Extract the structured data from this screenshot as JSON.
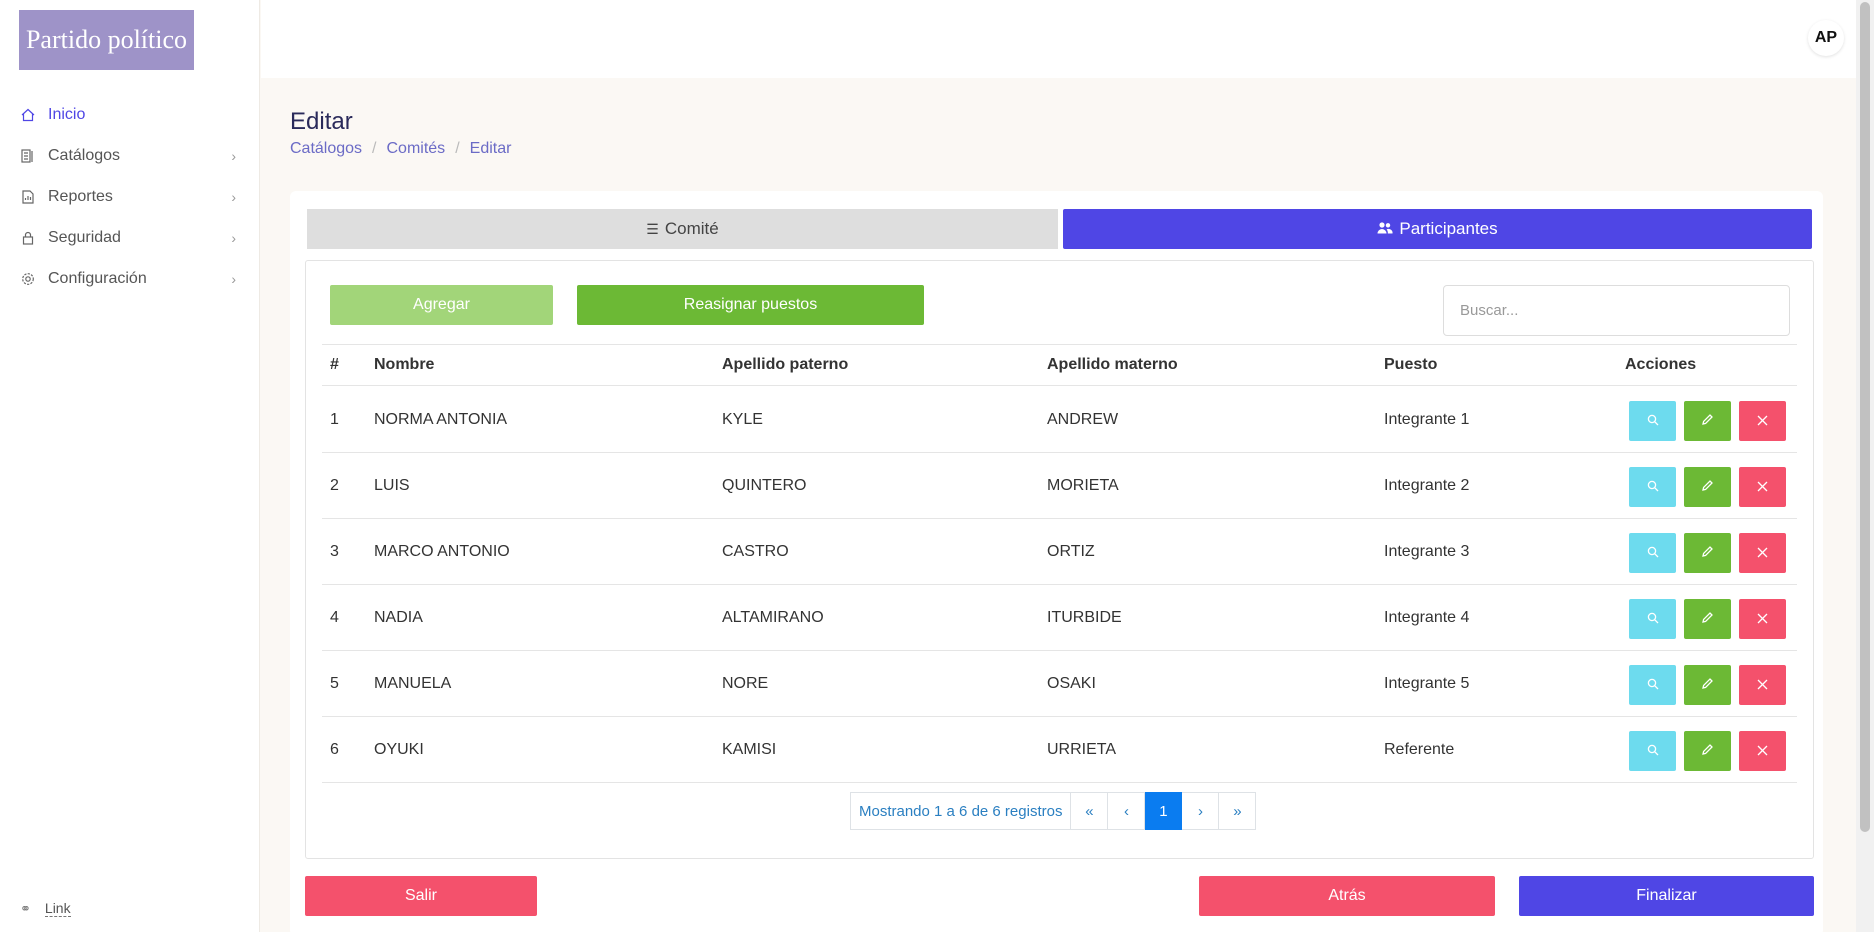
{
  "sidebar": {
    "logo": "Partido político",
    "items": [
      {
        "label": "Inicio",
        "icon": "home-icon"
      },
      {
        "label": "Catálogos",
        "icon": "catalog-icon"
      },
      {
        "label": "Reportes",
        "icon": "report-icon"
      },
      {
        "label": "Seguridad",
        "icon": "lock-icon"
      },
      {
        "label": "Configuración",
        "icon": "gear-icon"
      }
    ],
    "footer_link": "Link"
  },
  "topbar": {
    "avatar_initials": "AP"
  },
  "page": {
    "title": "Editar",
    "breadcrumb": [
      "Catálogos",
      "Comités",
      "Editar"
    ]
  },
  "tabs": {
    "comite": "Comité",
    "participantes": "Participantes"
  },
  "toolbar": {
    "agregar": "Agregar",
    "reasignar": "Reasignar puestos",
    "search_placeholder": "Buscar..."
  },
  "table": {
    "headers": {
      "num": "#",
      "nombre": "Nombre",
      "paterno": "Apellido paterno",
      "materno": "Apellido materno",
      "puesto": "Puesto",
      "acciones": "Acciones"
    },
    "rows": [
      {
        "num": "1",
        "nombre": "NORMA ANTONIA",
        "paterno": "KYLE",
        "materno": "ANDREW",
        "puesto": "Integrante 1"
      },
      {
        "num": "2",
        "nombre": "LUIS",
        "paterno": "QUINTERO",
        "materno": "MORIETA",
        "puesto": "Integrante 2"
      },
      {
        "num": "3",
        "nombre": "MARCO ANTONIO",
        "paterno": "CASTRO",
        "materno": "ORTIZ",
        "puesto": "Integrante 3"
      },
      {
        "num": "4",
        "nombre": "NADIA",
        "paterno": "ALTAMIRANO",
        "materno": "ITURBIDE",
        "puesto": "Integrante 4"
      },
      {
        "num": "5",
        "nombre": "MANUELA",
        "paterno": "NORE",
        "materno": "OSAKI",
        "puesto": "Integrante 5"
      },
      {
        "num": "6",
        "nombre": "OYUKI",
        "paterno": "KAMISI",
        "materno": "URRIETA",
        "puesto": "Referente"
      }
    ]
  },
  "pagination": {
    "info": "Mostrando 1 a 6 de 6 registros",
    "first": "«",
    "prev": "‹",
    "current": "1",
    "next": "›",
    "last": "»"
  },
  "footer_buttons": {
    "salir": "Salir",
    "atras": "Atrás",
    "finalizar": "Finalizar"
  },
  "colors": {
    "primary": "#4f46e5",
    "success": "#6cb935",
    "success_light": "#a2d579",
    "danger": "#f4516c",
    "info": "#6ddbee",
    "logo_bg": "#9e93c8"
  }
}
